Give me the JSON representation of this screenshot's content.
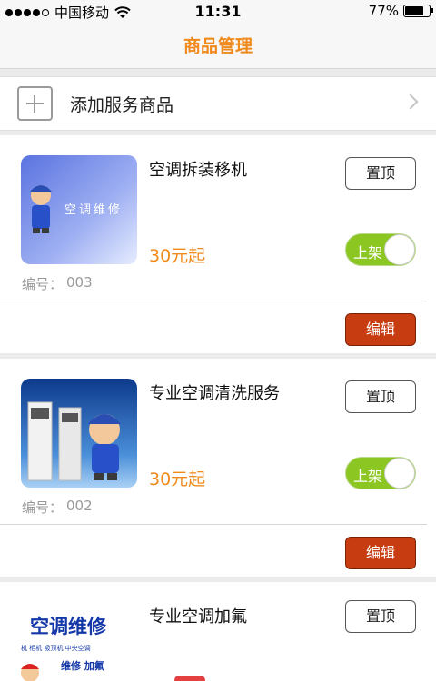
{
  "status_bar": {
    "carrier": "中国移动",
    "time": "11:31",
    "battery_text": "77%",
    "battery_level": 0.77,
    "icons": [
      "signal-dots-icon",
      "wifi-icon",
      "battery-icon"
    ]
  },
  "nav": {
    "title": "商品管理"
  },
  "add_service": {
    "label": "添加服务商品"
  },
  "colors": {
    "accent": "#f08a1c",
    "toggle_on": "#8cc623",
    "edit": "#c83c12"
  },
  "products": [
    {
      "name": "空调拆装移机",
      "price": "30元起",
      "code_label": "编号：",
      "code": "003",
      "pin_label": "置顶",
      "status_label": "上架",
      "edit_label": "编辑",
      "thumb_text": "空调维修"
    },
    {
      "name": "专业空调清洗服务",
      "price": "30元起",
      "code_label": "编号：",
      "code": "002",
      "pin_label": "置顶",
      "status_label": "上架",
      "edit_label": "编辑"
    },
    {
      "name": "专业空调加氟",
      "pin_label": "置顶",
      "thumb_title": "空调维修",
      "thumb_sub": "机 柜机 吸顶机 中央空调",
      "thumb_sub2": "维修  加氟"
    }
  ]
}
